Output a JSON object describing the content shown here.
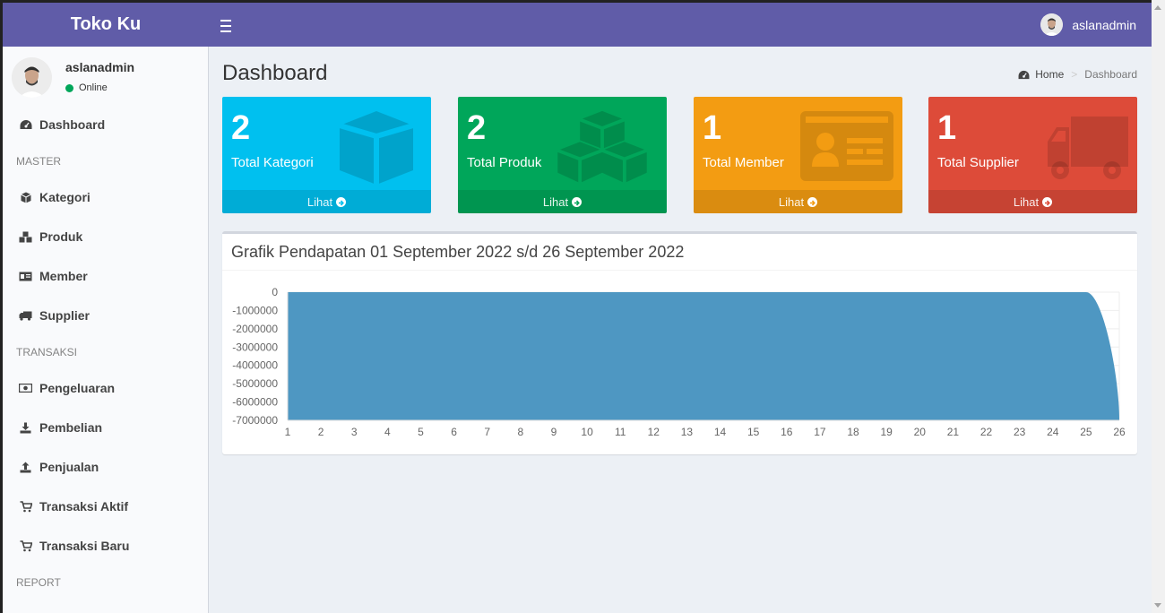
{
  "app": {
    "title": "Toko Ku",
    "user": "aslanadmin",
    "status": "Online"
  },
  "sidebar": {
    "items": [
      {
        "label": "Dashboard",
        "icon": "dashboard-icon"
      },
      {
        "header": "MASTER"
      },
      {
        "label": "Kategori",
        "icon": "cube-icon"
      },
      {
        "label": "Produk",
        "icon": "cubes-icon"
      },
      {
        "label": "Member",
        "icon": "id-card-icon"
      },
      {
        "label": "Supplier",
        "icon": "truck-icon"
      },
      {
        "header": "TRANSAKSI"
      },
      {
        "label": "Pengeluaran",
        "icon": "money-icon"
      },
      {
        "label": "Pembelian",
        "icon": "download-icon"
      },
      {
        "label": "Penjualan",
        "icon": "upload-icon"
      },
      {
        "label": "Transaksi Aktif",
        "icon": "cart-icon"
      },
      {
        "label": "Transaksi Baru",
        "icon": "cart-icon"
      },
      {
        "header": "REPORT"
      }
    ]
  },
  "page": {
    "title": "Dashboard",
    "breadcrumb": {
      "home": "Home",
      "current": "Dashboard"
    }
  },
  "cards": [
    {
      "value": "2",
      "label": "Total Kategori",
      "link": "Lihat",
      "color": "#00c0ef",
      "icon": "cube-icon"
    },
    {
      "value": "2",
      "label": "Total Produk",
      "link": "Lihat",
      "color": "#00a65a",
      "icon": "cubes-icon"
    },
    {
      "value": "1",
      "label": "Total Member",
      "link": "Lihat",
      "color": "#f39c12",
      "icon": "id-card-icon"
    },
    {
      "value": "1",
      "label": "Total Supplier",
      "link": "Lihat",
      "color": "#dd4b39",
      "icon": "truck-icon"
    }
  ],
  "chart": {
    "title": "Grafik Pendapatan 01 September 2022 s/d 26 September 2022"
  },
  "chart_data": {
    "type": "area",
    "title": "Grafik Pendapatan 01 September 2022 s/d 26 September 2022",
    "x": [
      1,
      2,
      3,
      4,
      5,
      6,
      7,
      8,
      9,
      10,
      11,
      12,
      13,
      14,
      15,
      16,
      17,
      18,
      19,
      20,
      21,
      22,
      23,
      24,
      25,
      26
    ],
    "series": [
      {
        "values": [
          0,
          0,
          0,
          0,
          0,
          0,
          0,
          0,
          0,
          0,
          0,
          0,
          0,
          0,
          0,
          0,
          0,
          0,
          0,
          0,
          0,
          0,
          0,
          0,
          0,
          -7000000
        ]
      }
    ],
    "ylim": [
      -7000000,
      0
    ],
    "yticks": [
      0,
      -1000000,
      -2000000,
      -3000000,
      -4000000,
      -5000000,
      -6000000,
      -7000000
    ],
    "fill_color": "#4e97c2",
    "grid": true
  }
}
